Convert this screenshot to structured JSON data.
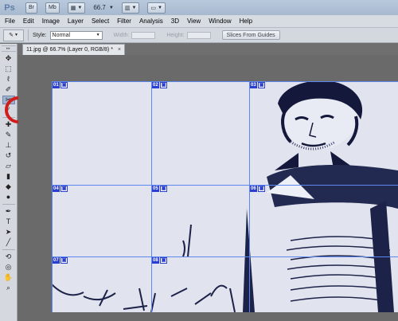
{
  "appbar": {
    "logo": "Ps",
    "br_button": "Br",
    "mb_button": "Mb",
    "zoom_level": "66.7"
  },
  "menubar": {
    "items": [
      "File",
      "Edit",
      "Image",
      "Layer",
      "Select",
      "Filter",
      "Analysis",
      "3D",
      "View",
      "Window",
      "Help"
    ]
  },
  "options": {
    "style_label": "Style:",
    "style_value": "Normal",
    "width_label": "Width:",
    "height_label": "Height:",
    "slices_button": "Slices From Guides"
  },
  "document": {
    "tab_title": "11.jpg @ 66.7% (Layer 0, RGB/8) *",
    "close_glyph": "×"
  },
  "slices": [
    {
      "num": "01"
    },
    {
      "num": "02"
    },
    {
      "num": "03"
    },
    {
      "num": "04"
    },
    {
      "num": "05"
    },
    {
      "num": "06"
    },
    {
      "num": "07"
    },
    {
      "num": "08"
    }
  ],
  "toolbox": {
    "tools": [
      "move-tool",
      "marquee-tool",
      "lasso-tool",
      "quick-select-tool",
      "slice-tool",
      "eyedropper-tool",
      "healing-tool",
      "brush-tool",
      "stamp-tool",
      "history-brush-tool",
      "eraser-tool",
      "gradient-tool",
      "blur-tool",
      "dodge-tool",
      "pen-tool",
      "type-tool",
      "path-select-tool",
      "shape-tool",
      "3d-rotate-tool",
      "3d-orbit-tool",
      "hand-tool",
      "zoom-tool"
    ],
    "active_tool": "slice-tool"
  },
  "colors": {
    "guide": "#5e86ef",
    "highlight": "#d11c1c",
    "badge": "#2a3fcf"
  }
}
